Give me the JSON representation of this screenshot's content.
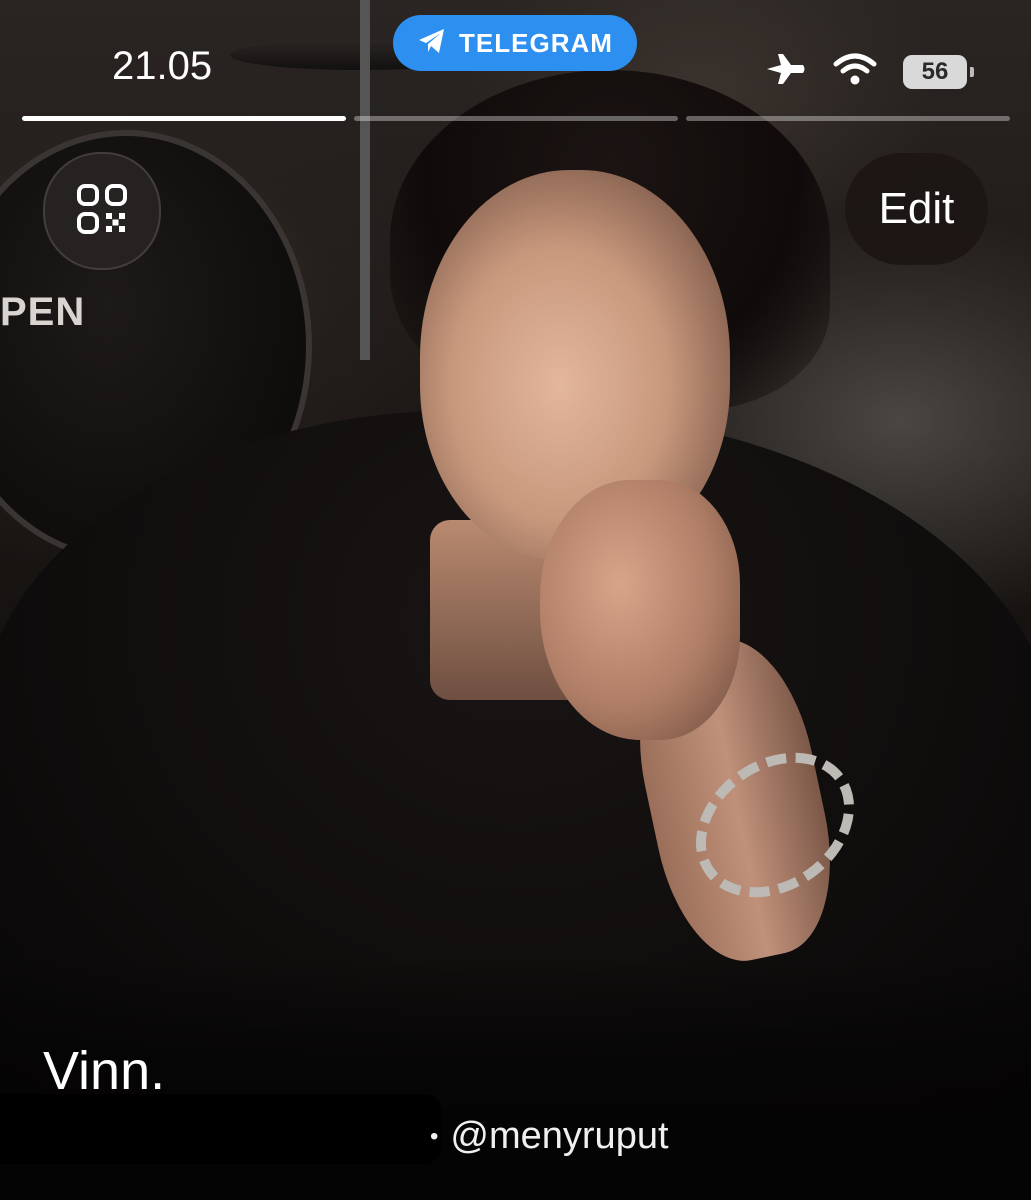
{
  "status_bar": {
    "time": "21.05",
    "app_pill_label": "TELEGRAM",
    "battery": "56",
    "icons": [
      "airplane-icon",
      "wifi-icon",
      "battery-icon"
    ]
  },
  "story_progress": {
    "segments": 3,
    "active": 1
  },
  "toolbar": {
    "qr_icon": "qr-code-icon",
    "edit_label": "Edit"
  },
  "photo": {
    "drum_lettering": "PEN"
  },
  "profile": {
    "name": "Vinn.",
    "username": "@menyruput",
    "separator": "•"
  },
  "colors": {
    "pill_accent": "#2d8ff0"
  }
}
